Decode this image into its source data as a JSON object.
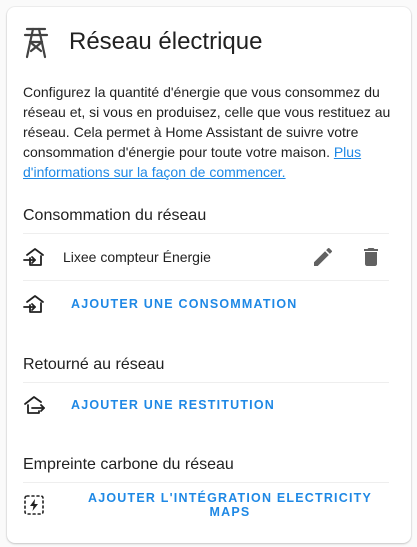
{
  "header": {
    "title": "Réseau électrique",
    "icon": "transmission-tower-icon"
  },
  "description": {
    "text": "Configurez la quantité d'énergie que vous consommez du réseau et, si vous en produisez, celle que vous restituez au réseau. Cela permet à Home Assistant de suivre votre consommation d'énergie pour toute votre maison. ",
    "link_text": "Plus d'informations sur la façon de commencer."
  },
  "consumption": {
    "title": "Consommation du réseau",
    "items": [
      {
        "label": "Lixee compteur Énergie"
      }
    ],
    "add_label": "AJOUTER UNE CONSOMMATION"
  },
  "returned": {
    "title": "Retourné au réseau",
    "add_label": "AJOUTER UNE RESTITUTION"
  },
  "carbon": {
    "title": "Empreinte carbone du réseau",
    "add_label": "AJOUTER L'INTÉGRATION ELECTRICITY MAPS"
  },
  "colors": {
    "accent": "#1e88e5",
    "icon": "#424242",
    "text": "#212121"
  }
}
